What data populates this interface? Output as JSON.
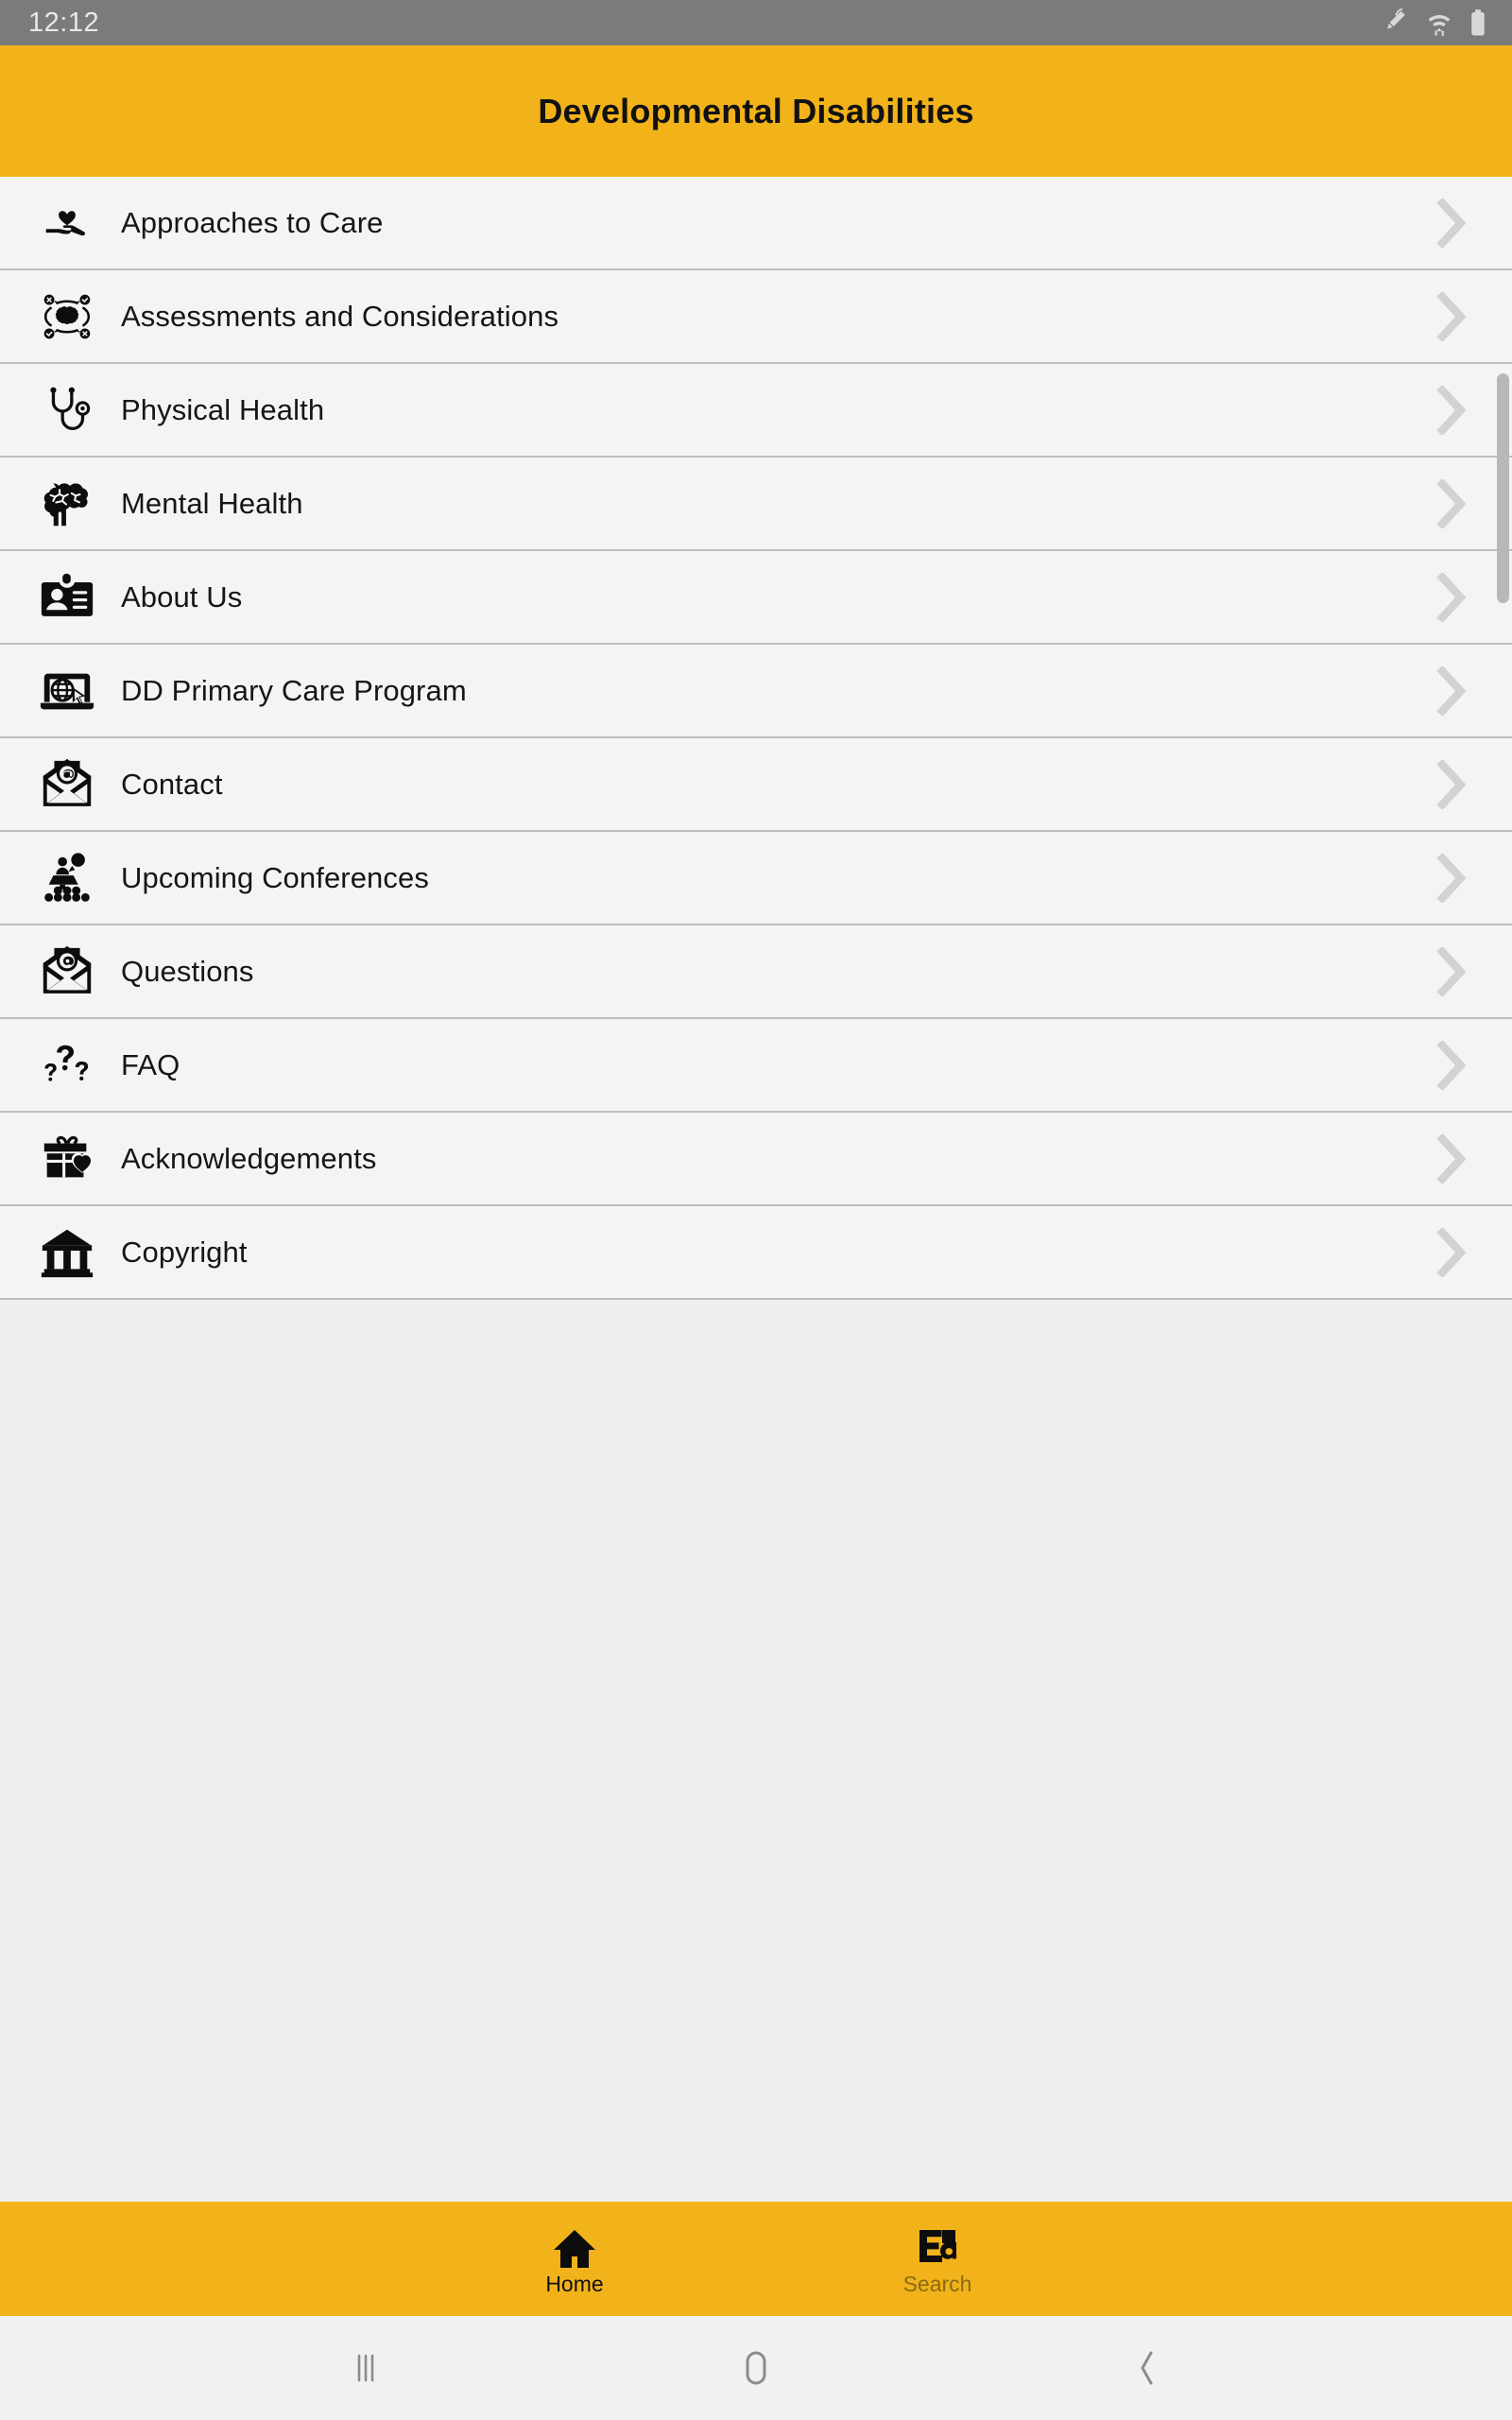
{
  "status_bar": {
    "clock": "12:12",
    "icons": [
      "spen-icon",
      "wifi-icon",
      "battery-icon"
    ]
  },
  "app_bar": {
    "title": "Developmental Disabilities",
    "background_color": "#F2B21A",
    "title_color": "#111111"
  },
  "list": {
    "chevron_icon": "chevron-right-icon",
    "row_background": "#F4F4F4",
    "divider_color": "#BDBDBD",
    "items": [
      {
        "label": "Approaches to Care",
        "icon": "hand-heart-icon"
      },
      {
        "label": "Assessments and Considerations",
        "icon": "brain-assessment-icon"
      },
      {
        "label": "Physical Health",
        "icon": "stethoscope-icon"
      },
      {
        "label": "Mental Health",
        "icon": "brain-icon"
      },
      {
        "label": "About Us",
        "icon": "id-badge-icon"
      },
      {
        "label": "DD Primary Care Program",
        "icon": "laptop-globe-icon"
      },
      {
        "label": "Contact",
        "icon": "email-envelope-icon"
      },
      {
        "label": "Upcoming Conferences",
        "icon": "conference-audience-icon"
      },
      {
        "label": "Questions",
        "icon": "email-envelope-icon"
      },
      {
        "label": "FAQ",
        "icon": "question-marks-icon"
      },
      {
        "label": "Acknowledgements",
        "icon": "gift-heart-icon"
      },
      {
        "label": "Copyright",
        "icon": "bank-building-icon"
      }
    ]
  },
  "bottom_nav": {
    "background_color": "#F2B21A",
    "items": [
      {
        "label": "Home",
        "icon": "home-icon",
        "active": true
      },
      {
        "label": "Search",
        "icon": "ea-search-icon",
        "active": false
      }
    ]
  },
  "android_nav": {
    "buttons": [
      {
        "icon": "recents-icon"
      },
      {
        "icon": "home-circle-icon"
      },
      {
        "icon": "back-chevron-icon"
      }
    ]
  }
}
